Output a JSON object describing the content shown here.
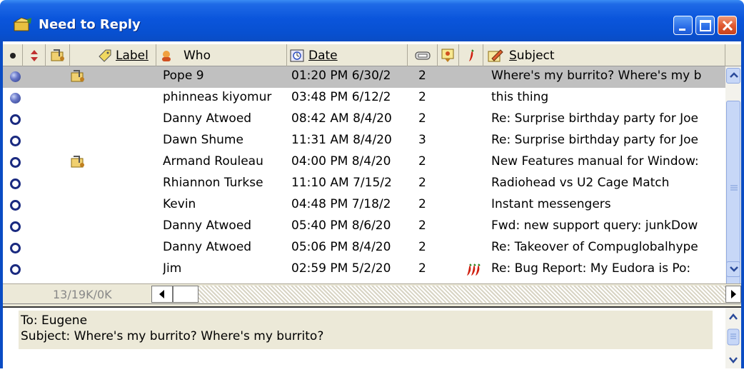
{
  "window": {
    "title": "Need to Reply",
    "buttons": [
      "minimize",
      "maximize",
      "close"
    ]
  },
  "columns": {
    "status_icon": "status-dot-icon",
    "priority_sort_icon": "up-down-arrows-icon",
    "attachment_icon": "attachment-icon",
    "label": "Label",
    "who": "Who",
    "date": "Date",
    "server_icon": "server-icon",
    "mood_icon": "mood-icon",
    "chili_icon": "chili-icon",
    "subject": "Subject"
  },
  "messages": [
    {
      "status": "filled",
      "attachment": true,
      "who": "Pope 9",
      "date": "01:20 PM 6/30/2",
      "count": "2",
      "chili": 0,
      "subject": "Where's my burrito? Where's my b",
      "selected": true
    },
    {
      "status": "filled",
      "attachment": false,
      "who": "phinneas kiyomur",
      "date": "03:48 PM 6/12/2",
      "count": "2",
      "chili": 0,
      "subject": "this thing",
      "selected": false
    },
    {
      "status": "open",
      "attachment": false,
      "who": "Danny Atwoed",
      "date": "08:42 AM 8/4/20",
      "count": "2",
      "chili": 0,
      "subject": "Re: Surprise birthday party for Joe",
      "selected": false
    },
    {
      "status": "open",
      "attachment": false,
      "who": "Dawn Shume",
      "date": "11:31 AM 8/4/20",
      "count": "3",
      "chili": 0,
      "subject": "Re: Surprise birthday party for Joe",
      "selected": false
    },
    {
      "status": "open",
      "attachment": true,
      "who": "Armand Rouleau",
      "date": "04:00 PM 8/4/20",
      "count": "2",
      "chili": 0,
      "subject": "New Features manual for Window:",
      "selected": false
    },
    {
      "status": "open",
      "attachment": false,
      "who": "Rhiannon Turkse",
      "date": "11:10 AM 7/15/2",
      "count": "2",
      "chili": 0,
      "subject": "Radiohead vs U2 Cage Match",
      "selected": false
    },
    {
      "status": "open",
      "attachment": false,
      "who": "Kevin",
      "date": "04:48 PM 7/18/2",
      "count": "2",
      "chili": 0,
      "subject": "Instant messengers",
      "selected": false
    },
    {
      "status": "open",
      "attachment": false,
      "who": "Danny Atwoed",
      "date": "05:40 PM 8/6/20",
      "count": "2",
      "chili": 0,
      "subject": "Fwd: new support query: junkDow",
      "selected": false
    },
    {
      "status": "open",
      "attachment": false,
      "who": "Danny Atwoed",
      "date": "05:06 PM 8/4/20",
      "count": "2",
      "chili": 0,
      "subject": "Re: Takeover of Compuglobalhype",
      "selected": false
    },
    {
      "status": "open",
      "attachment": false,
      "who": "Jim",
      "date": "02:59 PM 5/2/20",
      "count": "2",
      "chili": 3,
      "subject": "Re: Bug Report: My Eudora is Po:",
      "selected": false
    }
  ],
  "status_bar": {
    "size": "13/19K/0K"
  },
  "preview": {
    "to": "To:  Eugene",
    "subject": "Subject: Where's my burrito? Where's my burrito?"
  },
  "colors": {
    "title_bar": "#0a55dc",
    "selected_row": "#c0c0c0",
    "header_bg": "#ece9d8"
  }
}
